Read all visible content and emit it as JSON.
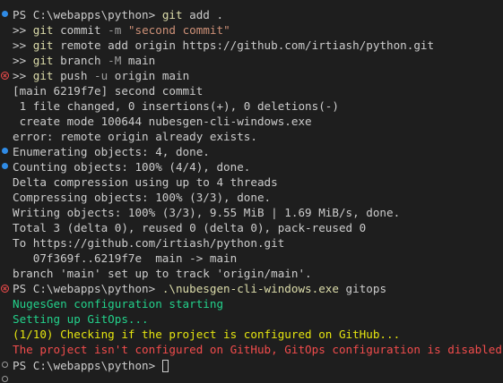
{
  "terminal": {
    "colors": {
      "background": "#1e1e1e",
      "text": "#cccccc",
      "command": "#dcdcaa",
      "flag": "#9e9e9e",
      "string": "#ce9178",
      "success": "#23d18b",
      "warning": "#e5e510",
      "error": "#f14c4c",
      "info_dot": "#2f8be6"
    },
    "prompt1": "PS C:\\webapps\\python> ",
    "line1_cmd": "git",
    "line1_rest": " add .",
    "cont_prefix": ">> ",
    "line2_cmd": "git",
    "line2_sp": " commit ",
    "line2_flag": "-m",
    "line2_str": " \"second commit\"",
    "line3_cmd": "git",
    "line3_rest": " remote add origin https://github.com/irtiash/python.git",
    "line4_cmd": "git",
    "line4_sp": " branch ",
    "line4_flag": "-M",
    "line4_rest": " main",
    "line5_cmd": "git",
    "line5_sp": " push ",
    "line5_flag": "-u",
    "line5_rest": " origin main",
    "output": [
      "[main 6219f7e] second commit",
      " 1 file changed, 0 insertions(+), 0 deletions(-)",
      " create mode 100644 nubesgen-cli-windows.exe",
      "error: remote origin already exists.",
      "Enumerating objects: 4, done.",
      "Counting objects: 100% (4/4), done.",
      "Delta compression using up to 4 threads",
      "Compressing objects: 100% (3/3), done.",
      "Writing objects: 100% (3/3), 9.55 MiB | 1.69 MiB/s, done.",
      "Total 3 (delta 0), reused 0 (delta 0), pack-reused 0",
      "To https://github.com/irtiash/python.git",
      "   07f369f..6219f7e  main -> main",
      "branch 'main' set up to track 'origin/main'."
    ],
    "prompt2": "PS C:\\webapps\\python> ",
    "line2b_cmd": ".\\nubesgen-cli-windows.exe",
    "line2b_rest": " gitops",
    "app_output": {
      "starting": "NugesGen configuration starting",
      "setting_up": "Setting up GitOps...",
      "checking": "(1/10) Checking if the project is configured on GitHub...",
      "error": "The project isn't configured on GitHub, GitOps configuration is disabled."
    },
    "prompt3": "PS C:\\webapps\\python> "
  }
}
